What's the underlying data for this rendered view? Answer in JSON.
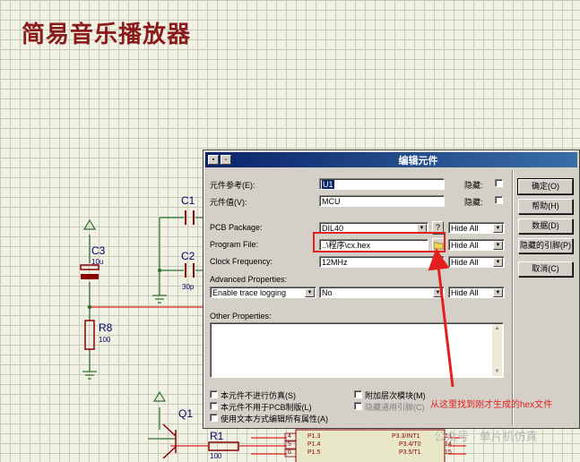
{
  "page_title": "简易音乐播放器",
  "schematic": {
    "C1": {
      "ref": "C1"
    },
    "C2": {
      "ref": "C2",
      "value": "30p"
    },
    "C3": {
      "ref": "C3",
      "value": "10u"
    },
    "R8": {
      "ref": "R8",
      "value": "100"
    },
    "R1": {
      "ref": "R1",
      "value": "100"
    },
    "Q1": {
      "ref": "Q1"
    },
    "left_pins": [
      {
        "num": "4",
        "name": "P1.3"
      },
      {
        "num": "5",
        "name": "P1.4"
      },
      {
        "num": "6",
        "name": "P1.5"
      }
    ],
    "right_pins": [
      {
        "num": "13",
        "name": "P3.3/INT1"
      },
      {
        "num": "14",
        "name": "P3.4/T0"
      },
      {
        "num": "15",
        "name": "P3.5/T1"
      }
    ]
  },
  "dialog": {
    "title": "编辑元件",
    "fields": {
      "ref_label": "元件参考(E):",
      "ref_value": "U1",
      "value_label": "元件值(V):",
      "value_value": "MCU",
      "hidden_label": "隐藏:",
      "package_label": "PCB Package:",
      "package_value": "DIL40",
      "package_help": "?",
      "program_label": "Program File:",
      "program_value": "..\\程序\\cx.hex",
      "clock_label": "Clock Frequency:",
      "clock_value": "12MHz",
      "adv_label": "Advanced Properties:",
      "adv_prop": "Enable trace logging",
      "adv_value": "No",
      "hide_all": "Hide All",
      "other_label": "Other Properties:"
    },
    "options": {
      "no_sim": "本元件不进行仿真(S)",
      "no_pcb": "本元件不用于PCB制版(L)",
      "edit_text": "使用文本方式编辑所有属性(A)",
      "attach_hier": "附加层次模块(M)",
      "hide_common": "隐藏通用引脚(C)"
    },
    "buttons": {
      "ok": "确定(O)",
      "help": "帮助(H)",
      "data": "数据(D)",
      "hidden_pins": "隐藏的引脚(P)",
      "cancel": "取消(C)"
    }
  },
  "annotation": "从这里找到刚才生成的hex文件",
  "watermark": "公众号 · 单片机仿真",
  "colors": {
    "wire": "#e32020",
    "component": "#8b0000",
    "green_wire": "#2c6e2c",
    "accent": "#0a246a"
  }
}
